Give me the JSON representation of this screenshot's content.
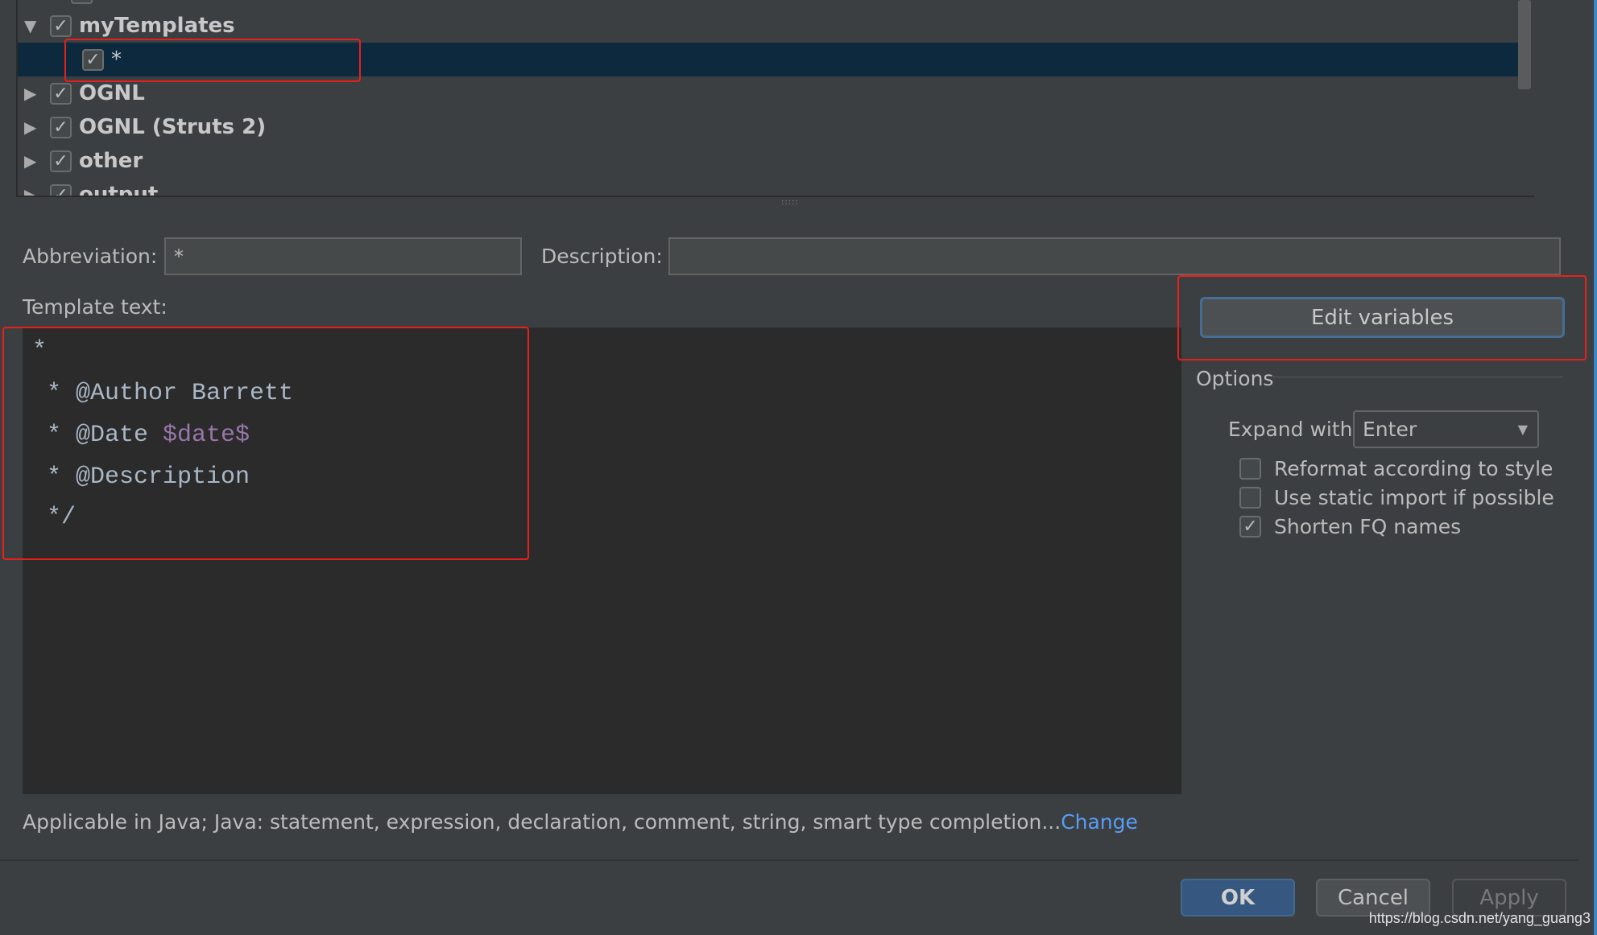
{
  "tree": {
    "items": [
      {
        "label": "myTemplates",
        "expanded": true,
        "checked": true
      },
      {
        "label": "*",
        "checked": true,
        "selected": true
      },
      {
        "label": "OGNL",
        "expanded": false,
        "checked": true
      },
      {
        "label": "OGNL (Struts 2)",
        "expanded": false,
        "checked": true
      },
      {
        "label": "other",
        "expanded": false,
        "checked": true
      },
      {
        "label": "output",
        "expanded": false,
        "checked": true
      }
    ]
  },
  "form": {
    "abbreviation_label": "Abbreviation:",
    "abbreviation_value": "*",
    "description_label": "Description:",
    "description_value": "",
    "template_text_label": "Template text:"
  },
  "template": {
    "lines": [
      "*",
      " * @Author Barrett",
      " * @Date ",
      " * @Description",
      " */"
    ],
    "date_var": "$date$"
  },
  "options": {
    "edit_variables": "Edit variables",
    "title": "Options",
    "expand_with_label": "Expand with",
    "expand_with_value": "Enter",
    "checks": [
      {
        "label": "Reformat according to style",
        "checked": false
      },
      {
        "label": "Use static import if possible",
        "checked": false
      },
      {
        "label": "Shorten FQ names",
        "checked": true
      }
    ]
  },
  "footer": {
    "applicable": "Applicable in Java; Java: statement, expression, declaration, comment, string, smart type completion...",
    "change_link": "Change",
    "ok": "OK",
    "cancel": "Cancel",
    "apply": "Apply",
    "watermark": "https://blog.csdn.net/yang_guang3"
  },
  "colors": {
    "selection": "#0d293e",
    "highlight": "#e8201c",
    "link": "#589df6",
    "ok_button": "#365880"
  }
}
